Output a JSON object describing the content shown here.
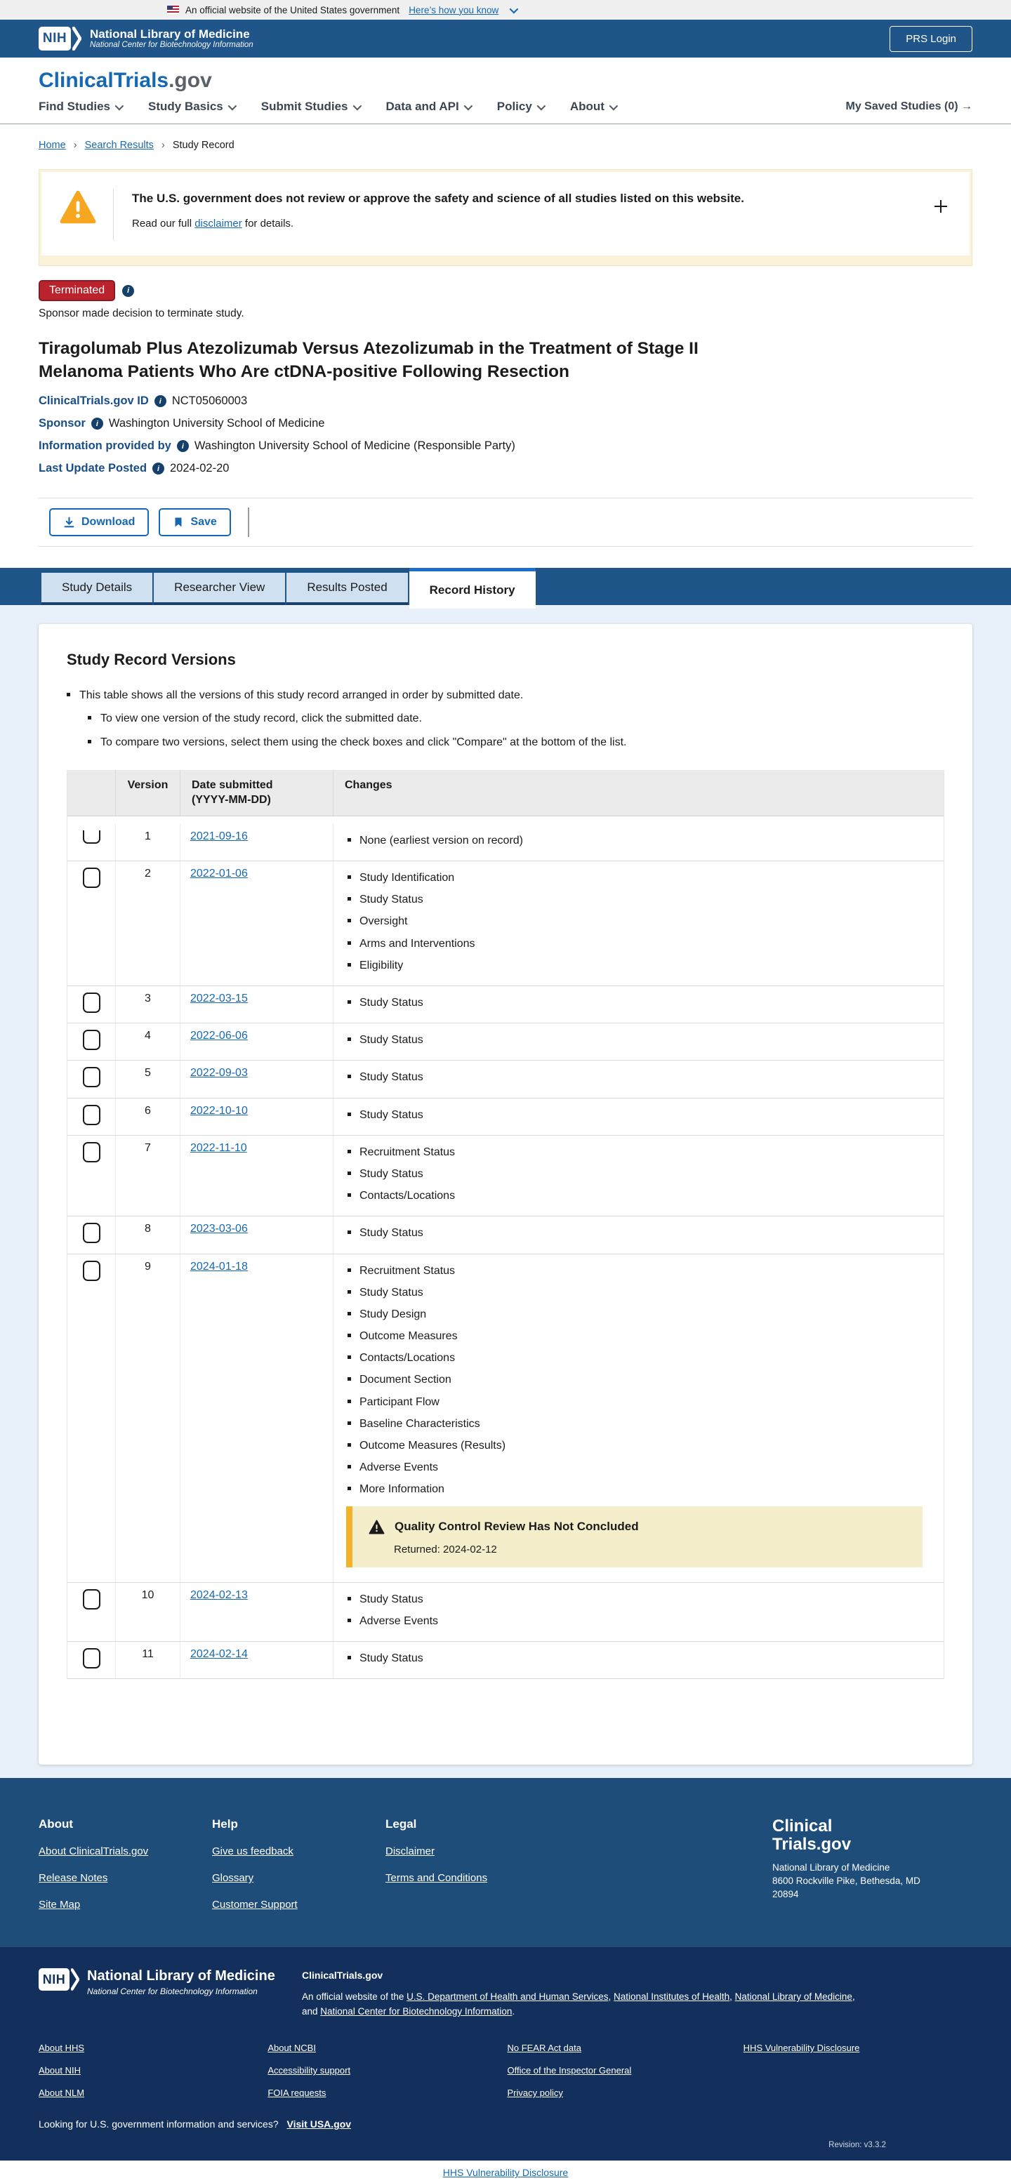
{
  "gov_banner": {
    "text": "An official website of the United States government",
    "link_label": "Here’s how you know"
  },
  "nlm_header": {
    "nih_acronym": "NIH",
    "title": "National Library of Medicine",
    "subtitle": "National Center for Biotechnology Information",
    "login_label": "PRS Login"
  },
  "brand": {
    "logo_main": "ClinicalTrials",
    "logo_suffix": ".gov"
  },
  "nav": {
    "items": [
      "Find Studies",
      "Study Basics",
      "Submit Studies",
      "Data and API",
      "Policy",
      "About"
    ],
    "saved_label": "My Saved Studies (0)",
    "saved_arrow": "→"
  },
  "breadcrumb": {
    "home": "Home",
    "search": "Search Results",
    "current": "Study Record",
    "separator": "›"
  },
  "disclaimer": {
    "title": "The U.S. government does not review or approve the safety and science of all studies listed on this website.",
    "body_pre": "Read our full ",
    "body_link": "disclaimer",
    "body_post": " for details."
  },
  "study": {
    "status_label": "Terminated",
    "status_note": "Sponsor made decision to terminate study.",
    "title": "Tiragolumab Plus Atezolizumab Versus Atezolizumab in the Treatment of Stage II Melanoma Patients Who Are ctDNA-positive Following Resection",
    "fields": [
      {
        "label": "ClinicalTrials.gov ID",
        "value": "NCT05060003"
      },
      {
        "label": "Sponsor",
        "value": "Washington University School of Medicine"
      },
      {
        "label": "Information provided by",
        "value": "Washington University School of Medicine (Responsible Party)"
      },
      {
        "label": "Last Update Posted",
        "value": "2024-02-20"
      }
    ]
  },
  "actions": {
    "download_label": "Download",
    "save_label": "Save"
  },
  "tabs": [
    {
      "label": "Study Details",
      "active": false
    },
    {
      "label": "Researcher View",
      "active": false
    },
    {
      "label": "Results Posted",
      "active": false
    },
    {
      "label": "Record History",
      "active": true
    }
  ],
  "record_versions": {
    "heading": "Study Record Versions",
    "intro": {
      "main": "This table shows all the versions of this study record arranged in order by submitted date.",
      "subs": [
        "To view one version of the study record, click the submitted date.",
        "To compare two versions, select them using the check boxes and click \"Compare\" at the bottom of the list."
      ]
    },
    "table": {
      "headers": {
        "version": "Version",
        "date_line1": "Date submitted",
        "date_line2": "(YYYY-MM-DD)",
        "changes": "Changes"
      },
      "rows": [
        {
          "version": "1",
          "date": "2021-09-16",
          "clipped": true,
          "changes": [
            "None (earliest version on record)"
          ]
        },
        {
          "version": "2",
          "date": "2022-01-06",
          "changes": [
            "Study Identification",
            "Study Status",
            "Oversight",
            "Arms and Interventions",
            "Eligibility"
          ]
        },
        {
          "version": "3",
          "date": "2022-03-15",
          "changes": [
            "Study Status"
          ]
        },
        {
          "version": "4",
          "date": "2022-06-06",
          "changes": [
            "Study Status"
          ]
        },
        {
          "version": "5",
          "date": "2022-09-03",
          "changes": [
            "Study Status"
          ]
        },
        {
          "version": "6",
          "date": "2022-10-10",
          "changes": [
            "Study Status"
          ]
        },
        {
          "version": "7",
          "date": "2022-11-10",
          "changes": [
            "Recruitment Status",
            "Study Status",
            "Contacts/Locations"
          ]
        },
        {
          "version": "8",
          "date": "2023-03-06",
          "changes": [
            "Study Status"
          ]
        },
        {
          "version": "9",
          "date": "2024-01-18",
          "changes": [
            "Recruitment Status",
            "Study Status",
            "Study Design",
            "Outcome Measures",
            "Contacts/Locations",
            "Document Section",
            "Participant Flow",
            "Baseline Characteristics",
            "Outcome Measures (Results)",
            "Adverse Events",
            "More Information"
          ],
          "qc": {
            "title": "Quality Control Review Has Not Concluded",
            "returned": "Returned: 2024-02-12"
          }
        },
        {
          "version": "10",
          "date": "2024-02-13",
          "changes": [
            "Study Status",
            "Adverse Events"
          ]
        },
        {
          "version": "11",
          "date": "2024-02-14",
          "changes": [
            "Study Status"
          ]
        }
      ]
    }
  },
  "footer_primary": {
    "columns": [
      {
        "heading": "About",
        "links": [
          "About ClinicalTrials.gov",
          "Release Notes",
          "Site Map"
        ]
      },
      {
        "heading": "Help",
        "links": [
          "Give us feedback",
          "Glossary",
          "Customer Support"
        ]
      },
      {
        "heading": "Legal",
        "links": [
          "Disclaimer",
          "Terms and Conditions"
        ]
      }
    ],
    "logo_line1": "Clinical",
    "logo_line2": "Trials.gov",
    "address_lines": [
      "National Library of Medicine",
      "8600 Rockville Pike, Bethesda, MD",
      "20894"
    ]
  },
  "footer_secondary": {
    "nih_acronym": "NIH",
    "nlm_title": "National Library of Medicine",
    "nlm_subtitle": "National Center for Biotechnology Information",
    "site_name": "ClinicalTrials.gov",
    "official_segments": [
      {
        "text": "An official website of the "
      },
      {
        "text": "U.S. Department of Health and Human Services",
        "link": true
      },
      {
        "text": ", "
      },
      {
        "text": "National Institutes of Health",
        "link": true
      },
      {
        "text": ", "
      },
      {
        "text": "National Library of Medicine",
        "link": true
      },
      {
        "text": ","
      },
      {
        "break": true
      },
      {
        "text": "and "
      },
      {
        "text": "National Center for Biotechnology Information",
        "link": true
      },
      {
        "text": "."
      }
    ],
    "link_columns": [
      [
        "About HHS",
        "About NIH",
        "About NLM"
      ],
      [
        "About NCBI",
        "Accessibility support",
        "FOIA requests"
      ],
      [
        "No FEAR Act data",
        "Office of the Inspector General",
        "Privacy policy"
      ],
      [
        "HHS Vulnerability Disclosure"
      ]
    ],
    "usa_prompt": "Looking for U.S. government information and services?",
    "usa_link": "Visit USA.gov",
    "revision": "Revision: v3.3.2"
  },
  "bottom_bar": {
    "link": "HHS Vulnerability Disclosure"
  }
}
